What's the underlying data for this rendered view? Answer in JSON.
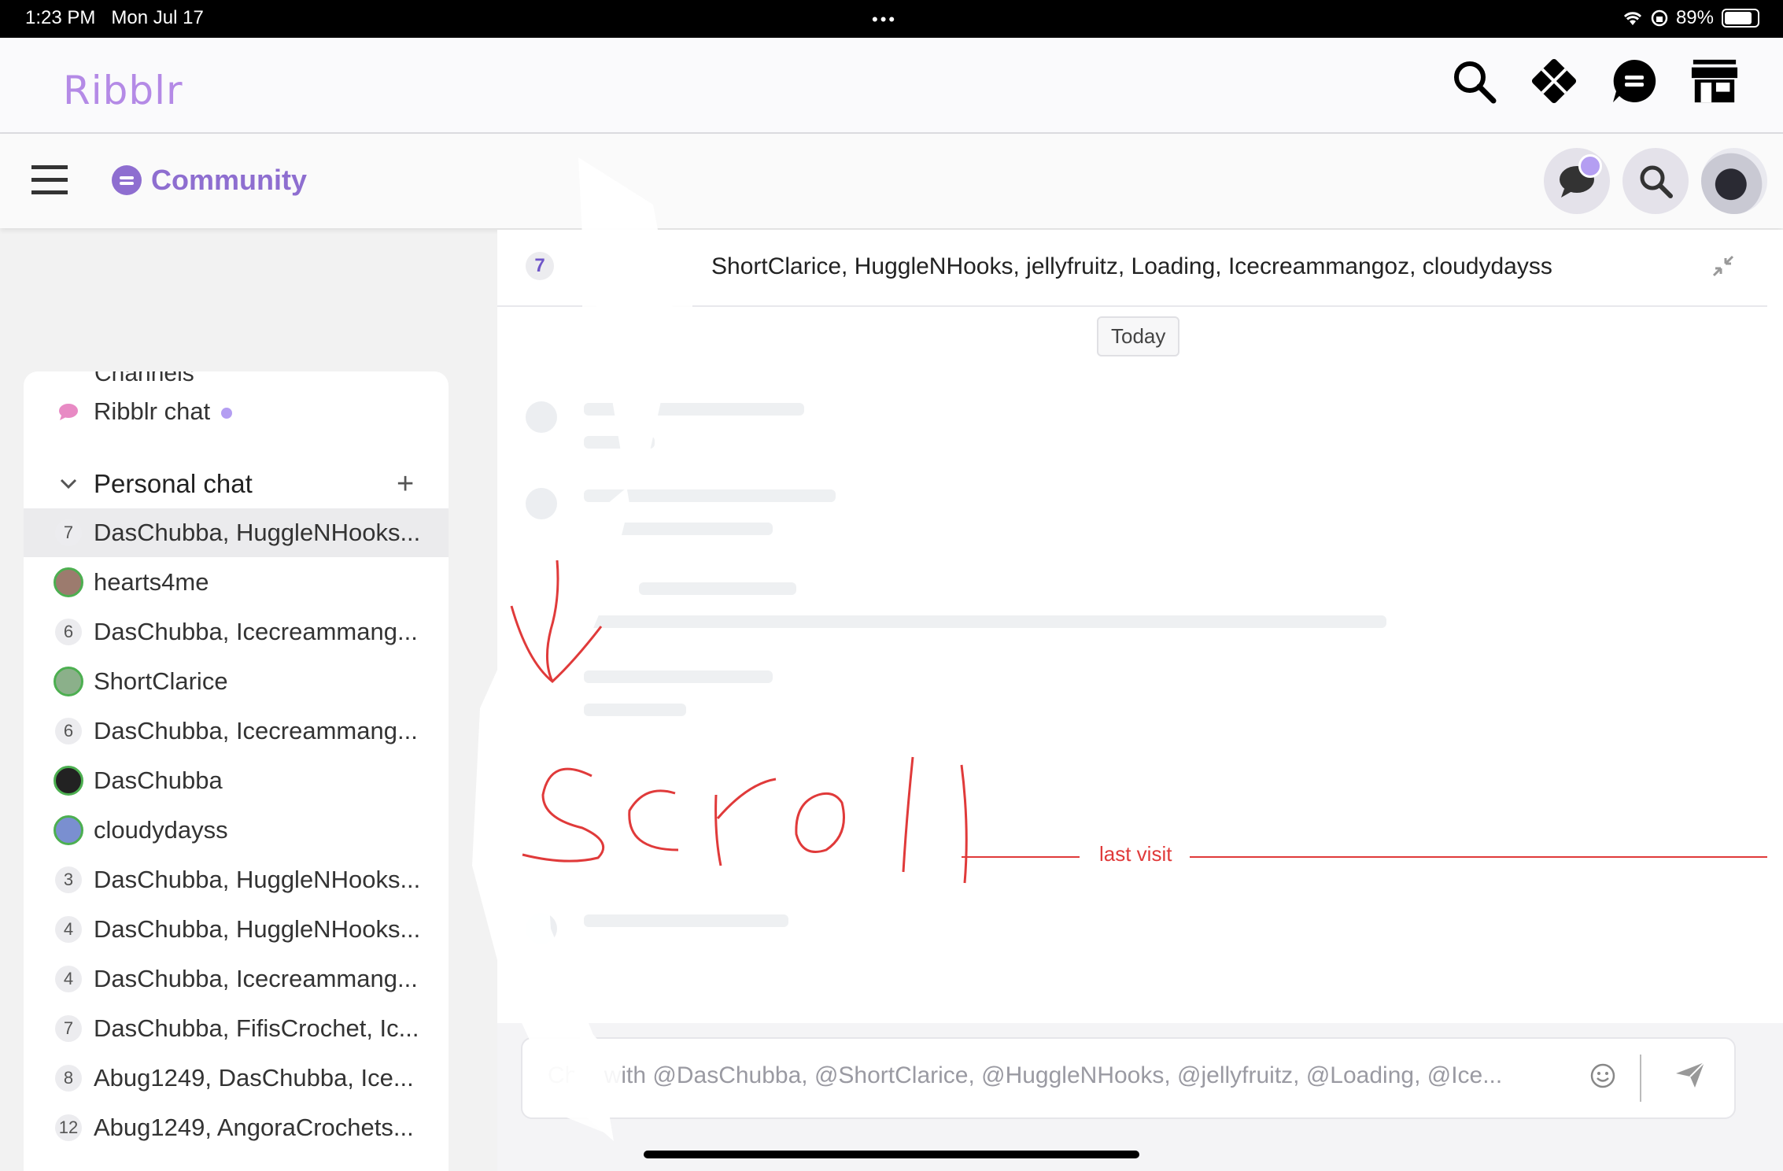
{
  "status_bar": {
    "time": "1:23 PM",
    "date": "Mon Jul 17",
    "dots": "•••",
    "battery": "89%"
  },
  "app": {
    "logo": "Ribblr",
    "top_icons": [
      "search-icon",
      "pattern-icon",
      "chat-icon",
      "store-icon"
    ]
  },
  "subheader": {
    "section": "Community"
  },
  "sidebar": {
    "cut_label": "Channels",
    "ribblr_chat": "Ribblr chat",
    "personal_chat": "Personal chat",
    "add": "+",
    "items": [
      {
        "badge": "7",
        "label": "DasChubba, HuggleNHooks...",
        "avatar": false,
        "active": true
      },
      {
        "badge": "",
        "label": "hearts4me",
        "avatar": true,
        "active": false
      },
      {
        "badge": "6",
        "label": "DasChubba, Icecreammang...",
        "avatar": false,
        "active": false
      },
      {
        "badge": "",
        "label": "ShortClarice",
        "avatar": true,
        "active": false
      },
      {
        "badge": "6",
        "label": "DasChubba, Icecreammang...",
        "avatar": false,
        "active": false
      },
      {
        "badge": "",
        "label": "DasChubba",
        "avatar": true,
        "active": false
      },
      {
        "badge": "",
        "label": "cloudydayss",
        "avatar": true,
        "active": false
      },
      {
        "badge": "3",
        "label": "DasChubba, HuggleNHooks...",
        "avatar": false,
        "active": false
      },
      {
        "badge": "4",
        "label": "DasChubba, HuggleNHooks...",
        "avatar": false,
        "active": false
      },
      {
        "badge": "4",
        "label": "DasChubba, Icecreammang...",
        "avatar": false,
        "active": false
      },
      {
        "badge": "7",
        "label": "DasChubba, FifisCrochet, Ic...",
        "avatar": false,
        "active": false
      },
      {
        "badge": "8",
        "label": "Abug1249, DasChubba, Ice...",
        "avatar": false,
        "active": false
      },
      {
        "badge": "12",
        "label": "Abug1249, AngoraCrochets...",
        "avatar": false,
        "active": false
      }
    ]
  },
  "chat": {
    "member_count": "7",
    "members": "ShortClarice, HuggleNHooks, jellyfruitz, Loading, Icecreammangoz, cloudydayss",
    "today": "Today",
    "last_visit": "last visit",
    "placeholder": "Chat with @DasChubba, @ShortClarice, @HuggleNHooks, @jellyfruitz, @Loading, @Ice..."
  },
  "annotation": {
    "handwritten": "scroll",
    "color": "#e03a3a"
  },
  "colors": {
    "accent": "#8e6ed0",
    "logo": "#b48ae6",
    "notification": "#b49ef2"
  }
}
